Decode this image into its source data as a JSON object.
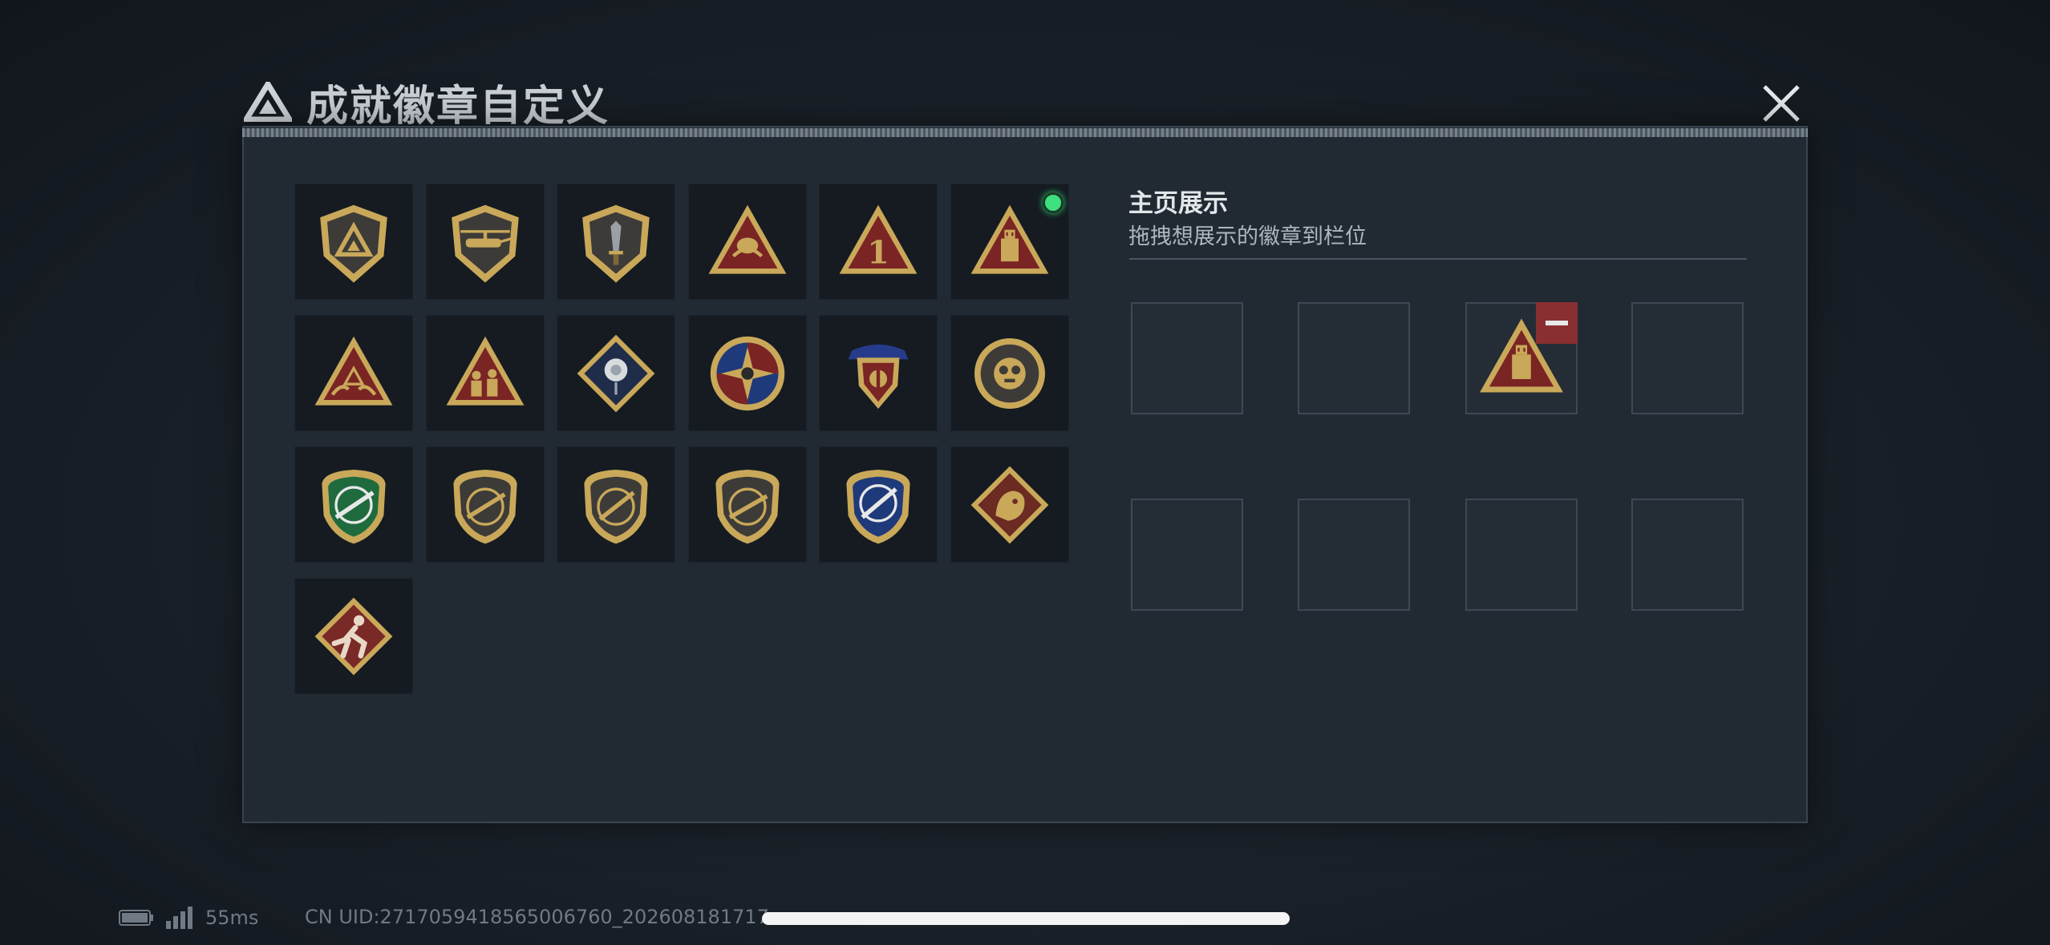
{
  "title": "成就徽章自定义",
  "close_icon": "close-icon",
  "badges": [
    {
      "row": 0,
      "col": 0,
      "icon": "shield-logo-badge"
    },
    {
      "row": 0,
      "col": 1,
      "icon": "helicopter-shield-badge"
    },
    {
      "row": 0,
      "col": 2,
      "icon": "knife-shield-badge"
    },
    {
      "row": 0,
      "col": 3,
      "icon": "triangle-wave-badge"
    },
    {
      "row": 0,
      "col": 4,
      "icon": "triangle-number-one-badge"
    },
    {
      "row": 0,
      "col": 5,
      "icon": "triangle-usb-badge",
      "active": true
    },
    {
      "row": 1,
      "col": 0,
      "icon": "triangle-hands-badge"
    },
    {
      "row": 1,
      "col": 1,
      "icon": "triangle-squad-badge"
    },
    {
      "row": 1,
      "col": 2,
      "icon": "diamond-rose-badge"
    },
    {
      "row": 1,
      "col": 3,
      "icon": "compass-star-medal-badge"
    },
    {
      "row": 1,
      "col": 4,
      "icon": "crest-shield-stars-badge"
    },
    {
      "row": 1,
      "col": 5,
      "icon": "round-mask-medal-badge"
    },
    {
      "row": 2,
      "col": 0,
      "icon": "green-rifle-crest-badge"
    },
    {
      "row": 2,
      "col": 1,
      "icon": "rifle-shield-badge"
    },
    {
      "row": 2,
      "col": 2,
      "icon": "rifle-shield-badge-2"
    },
    {
      "row": 2,
      "col": 3,
      "icon": "rifle-shield-badge-3"
    },
    {
      "row": 2,
      "col": 4,
      "icon": "blue-knife-crest-badge"
    },
    {
      "row": 2,
      "col": 5,
      "icon": "dragon-diamond-badge"
    },
    {
      "row": 3,
      "col": 0,
      "icon": "runner-diamond-badge"
    }
  ],
  "showcase": {
    "title": "主页展示",
    "subtitle": "拖拽想展示的徽章到栏位",
    "slots": [
      {
        "filled": false
      },
      {
        "filled": false
      },
      {
        "filled": true,
        "badge": "triangle-usb-badge",
        "remove_icon": "minus-icon"
      },
      {
        "filled": false
      },
      {
        "filled": false
      },
      {
        "filled": false
      },
      {
        "filled": false
      },
      {
        "filled": false
      }
    ]
  },
  "status": {
    "battery_icon": "battery-icon",
    "signal_icon": "signal-icon",
    "ping": "55ms",
    "uid": "CN UID:2717059418565006760_202608181717"
  },
  "colors": {
    "gold": "#c9a85a",
    "red": "#7a2424",
    "green_dot": "#3fe07e",
    "remove_red": "#8a2f31"
  }
}
